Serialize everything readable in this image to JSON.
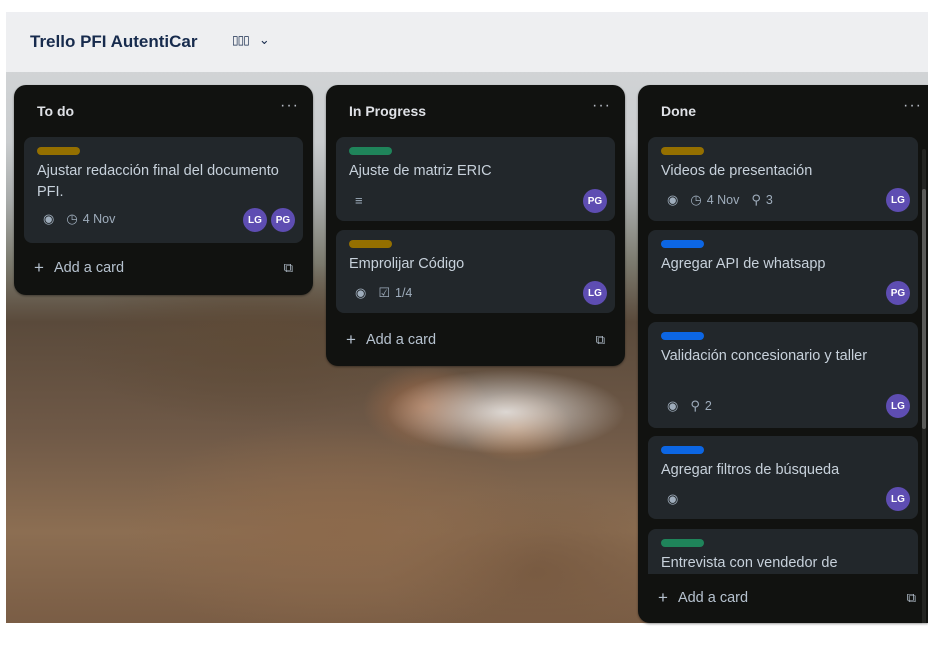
{
  "board": {
    "title": "Trello PFI AutentiCar",
    "view_icon": "board-view-icon",
    "view_glyph": "▯▯▯",
    "chevron": "⌄"
  },
  "colors": {
    "list_bg": "#111210",
    "card_bg": "#22272b",
    "label_yellow": "#946f00",
    "label_green": "#1f845a",
    "label_blue": "#0c66e4",
    "avatar_purple": "#5e4db2"
  },
  "lists": [
    {
      "title": "To do",
      "menu": "···",
      "add_card": "Add a card",
      "cards": [
        {
          "label_color": "#946f00",
          "title": "Ajustar redacción final del documento PFI.",
          "watch": "◉",
          "due": "4 Nov",
          "members": [
            "LG",
            "PG"
          ]
        }
      ]
    },
    {
      "title": "In Progress",
      "menu": "···",
      "add_card": "Add a card",
      "cards": [
        {
          "label_color": "#1f845a",
          "title": "Ajuste de matriz ERIC",
          "members": [
            "PG"
          ]
        },
        {
          "label_color": "#946f00",
          "title": "Emprolijar Código",
          "checklist": "1/4",
          "members": [
            "LG"
          ]
        }
      ]
    },
    {
      "title": "Done",
      "menu": "···",
      "add_card": "Add a card",
      "cards": [
        {
          "label_color": "#946f00",
          "title": "Videos de presentación",
          "due": "4 Nov",
          "attachments": "3",
          "members": [
            "LG"
          ]
        },
        {
          "label_color": "#0c66e4",
          "title": "Agregar API de whatsapp",
          "members": [
            "PG"
          ]
        },
        {
          "label_color": "#0c66e4",
          "title": "Validación concesionario y taller",
          "attachments": "2",
          "members": [
            "LG"
          ]
        },
        {
          "label_color": "#0c66e4",
          "title": "Agregar filtros de búsqueda",
          "members": [
            "LG"
          ]
        },
        {
          "label_color": "#1f845a",
          "title": "Entrevista con vendedor de"
        }
      ]
    }
  ]
}
